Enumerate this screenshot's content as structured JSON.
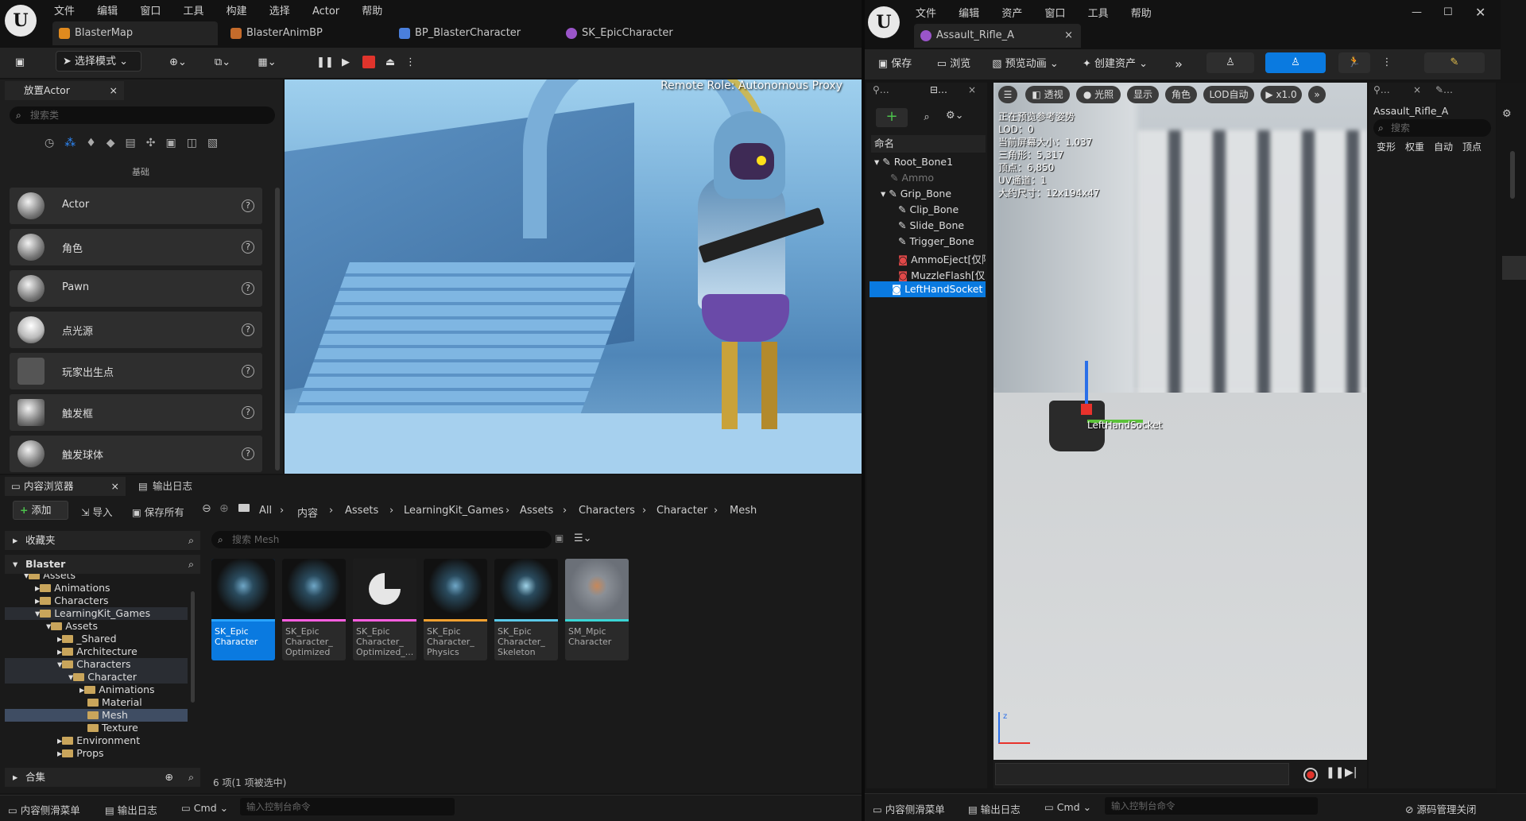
{
  "left_window": {
    "menu": [
      "文件",
      "编辑",
      "窗口",
      "工具",
      "构建",
      "选择",
      "Actor",
      "帮助"
    ],
    "tabs": [
      "BlasterMap",
      "BlasterAnimBP",
      "BP_BlasterCharacter",
      "SK_EpicCharacter"
    ],
    "toolbar": {
      "mode_label": "选择模式"
    },
    "place_actors": {
      "title": "放置Actor",
      "search_placeholder": "搜索类",
      "category": "基础",
      "items": [
        "Actor",
        "角色",
        "Pawn",
        "点光源",
        "玩家出生点",
        "触发框",
        "触发球体"
      ]
    },
    "viewport": {
      "overlay_text": "Remote Role: Autonomous Proxy"
    },
    "content_browser": {
      "tab_title": "内容浏览器",
      "log_tab": "输出日志",
      "add_label": "添加",
      "import_label": "导入",
      "save_all_label": "保存所有",
      "breadcrumb": [
        "All",
        "内容",
        "Assets",
        "LearningKit_Games",
        "Assets",
        "Characters",
        "Character",
        "Mesh"
      ],
      "favorites_label": "收藏夹",
      "project_label": "Blaster",
      "tree": [
        "Assets",
        "Animations",
        "Characters",
        "LearningKit_Games",
        "Assets",
        "_Shared",
        "Architecture",
        "Characters",
        "Character",
        "Animations",
        "Material",
        "Mesh",
        "Texture",
        "Environment",
        "Props"
      ],
      "collections_label": "合集",
      "search_placeholder": "搜索 Mesh",
      "assets": [
        {
          "name": "SK_Epic Character",
          "color": "#29a3ff"
        },
        {
          "name": "SK_Epic Character_ Optimized",
          "color": "#ff5edf"
        },
        {
          "name": "SK_Epic Character_ Optimized_...",
          "color": "#ff5edf"
        },
        {
          "name": "SK_Epic Character_ Physics",
          "color": "#f0a030"
        },
        {
          "name": "SK_Epic Character_ Skeleton",
          "color": "#5ac8e8"
        },
        {
          "name": "SM_Mpic Character",
          "color": "#3ad6d6"
        }
      ],
      "status": "6 项(1 项被选中)"
    },
    "bottom": {
      "drawer": "内容侧滑菜单",
      "log": "输出日志",
      "cmd": "Cmd",
      "console_placeholder": "输入控制台命令"
    }
  },
  "right_window": {
    "menu": [
      "文件",
      "编辑",
      "资产",
      "窗口",
      "工具",
      "帮助"
    ],
    "tab": "Assault_Rifle_A",
    "toolbar": {
      "save": "保存",
      "browse": "浏览",
      "preview_anim": "预览动画",
      "create_asset": "创建资产"
    },
    "skeleton_tree": {
      "name_header": "命名",
      "bones": [
        "Root_Bone1",
        "Ammo",
        "Grip_Bone",
        "Clip_Bone",
        "Slide_Bone",
        "Trigger_Bone",
        "AmmoEject[仅限",
        "MuzzleFlash[仅限",
        "LeftHandSocket"
      ]
    },
    "viewport": {
      "buttons": [
        "透视",
        "光照",
        "显示",
        "角色",
        "LOD自动",
        "x1.0"
      ],
      "overlay_lines": [
        "正在预览参考姿势",
        "LOD：0",
        "当前屏幕大小：1.037",
        "三角形：5,317",
        "顶点：6,850",
        "UV通道：1",
        "大约尺寸：12x194x47"
      ],
      "socket_label": "LeftHandSocket"
    },
    "details": {
      "title": "Assault_Rifle_A",
      "search_placeholder": "搜索",
      "tabs": [
        "变形",
        "权重",
        "自动",
        "顶点"
      ]
    },
    "bottom": {
      "drawer": "内容侧滑菜单",
      "log": "输出日志",
      "cmd": "Cmd",
      "console_placeholder": "输入控制台命令",
      "source_control": "源码管理关闭"
    }
  }
}
